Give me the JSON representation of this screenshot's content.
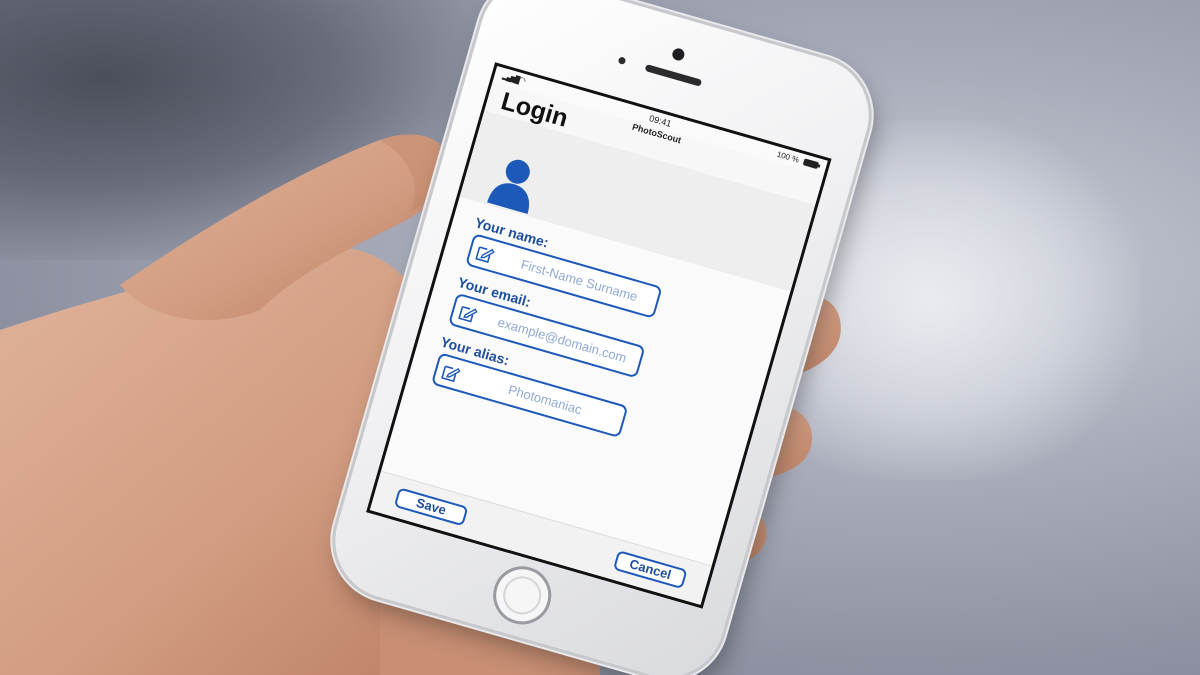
{
  "status_bar": {
    "signal": "▂▄▆█",
    "wifi": "◠",
    "time": "09:41",
    "battery": "100 %"
  },
  "app": {
    "name": "PhotoScout",
    "title": "Login"
  },
  "form": {
    "name": {
      "label": "Your name:",
      "placeholder": "First-Name Surname",
      "icon": "edit-icon"
    },
    "email": {
      "label": "Your email:",
      "placeholder": "example@domain.com",
      "icon": "edit-icon"
    },
    "alias": {
      "label": "Your alias:",
      "placeholder": "Photomaniac",
      "icon": "edit-icon"
    }
  },
  "actions": {
    "save_label": "Save",
    "cancel_label": "Cancel"
  },
  "colors": {
    "accent": "#1d59b8",
    "label": "#1d4e9c",
    "placeholder": "#8fa9d1",
    "screen_bg": "#fafafa",
    "header_band": "#eeeeee"
  }
}
